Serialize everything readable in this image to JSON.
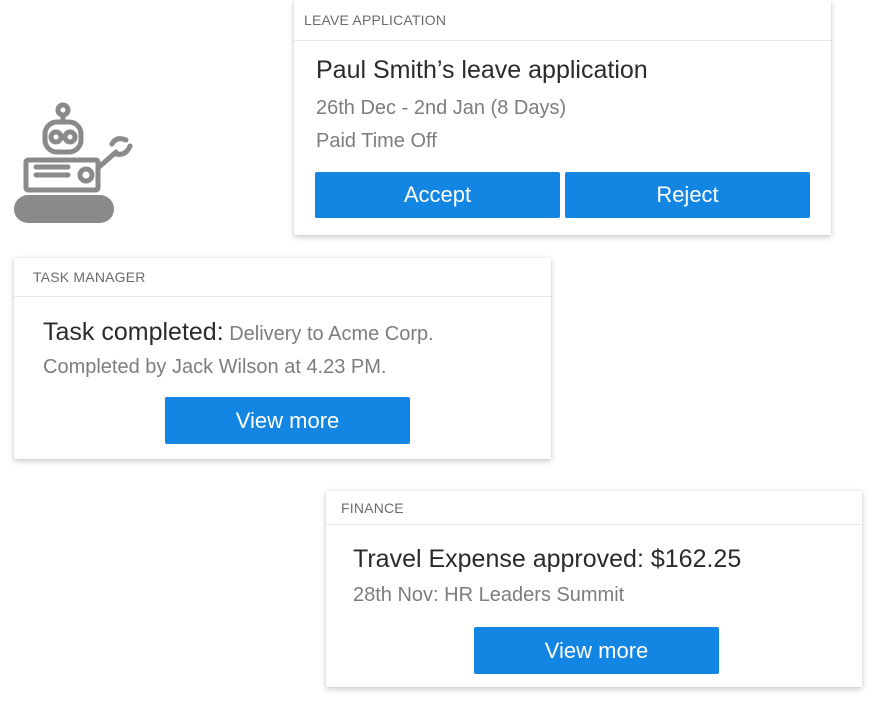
{
  "cards": {
    "leave": {
      "header": "LEAVE APPLICATION",
      "title": "Paul Smith’s leave application",
      "dates": "26th Dec - 2nd Jan (8 Days)",
      "type": "Paid Time Off",
      "accept_label": "Accept",
      "reject_label": "Reject"
    },
    "task": {
      "header": "TASK MANAGER",
      "title_bold": "Task completed:",
      "title_rest": " Delivery to Acme Corp.",
      "detail": "Completed by Jack Wilson at 4.23 PM.",
      "button_label": "View more"
    },
    "finance": {
      "header": "FINANCE",
      "title": "Travel Expense approved: $162.25",
      "detail": "28th Nov: HR Leaders Summit",
      "button_label": "View more"
    }
  },
  "icons": {
    "robot": "robot-icon"
  },
  "colors": {
    "accent": "#1386e3",
    "robot": "#8a8a8a"
  }
}
